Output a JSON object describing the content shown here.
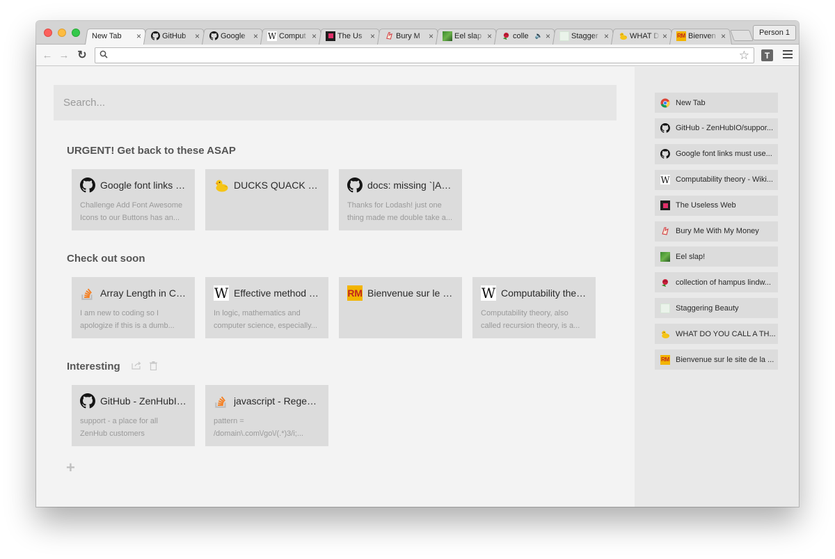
{
  "browser": {
    "profile_label": "Person 1",
    "tabs": [
      {
        "title": "New Tab",
        "icon": "none",
        "active": true
      },
      {
        "title": "GitHub",
        "icon": "github-icon"
      },
      {
        "title": "Google",
        "icon": "github-icon"
      },
      {
        "title": "Comput",
        "icon": "wikipedia-icon"
      },
      {
        "title": "The Us",
        "icon": "useless-web-icon"
      },
      {
        "title": "Bury M",
        "icon": "money-icon"
      },
      {
        "title": "Eel slap",
        "icon": "eel-icon"
      },
      {
        "title": "colle",
        "icon": "rose-icon",
        "audio": "speaker-icon"
      },
      {
        "title": "Stagger",
        "icon": "staggering-icon"
      },
      {
        "title": "WHAT D",
        "icon": "duck-icon"
      },
      {
        "title": "Bienven",
        "icon": "rm-icon"
      }
    ],
    "tab_close_glyph": "×",
    "omnibox": {
      "value": "",
      "placeholder": ""
    },
    "extension_label": "T"
  },
  "search": {
    "placeholder": "Search..."
  },
  "groups": [
    {
      "title": "URGENT! Get back to these ASAP",
      "cards": [
        {
          "icon": "github-icon",
          "title": "Google font links m...",
          "desc": "Challenge Add Font Awesome Icons to our Buttons has an..."
        },
        {
          "icon": "duck-icon",
          "title": "DUCKS QUACK ME ...",
          "desc": ""
        },
        {
          "icon": "github-icon",
          "title": "docs: missing `|Arr...",
          "desc": "Thanks for Lodash! just one thing made me double take a..."
        }
      ]
    },
    {
      "title": "Check out soon",
      "cards": [
        {
          "icon": "stackoverflow-icon",
          "title": "Array Length in C - ...",
          "desc": "I am new to coding so I apologize if this is a dumb..."
        },
        {
          "icon": "wikipedia-icon",
          "title": "Effective method - ...",
          "desc": "In logic, mathematics and computer science, especially..."
        },
        {
          "icon": "rm-icon",
          "title": "Bienvenue sur le sit...",
          "desc": ""
        },
        {
          "icon": "wikipedia-icon",
          "title": "Computability theo...",
          "desc": "Computability theory, also called recursion theory, is a..."
        }
      ]
    },
    {
      "title": "Interesting",
      "tools": [
        "share-icon",
        "trash-icon"
      ],
      "cards": [
        {
          "icon": "github-icon",
          "title": "GitHub - ZenHubIO/...",
          "desc": "support - a place for all ZenHub customers"
        },
        {
          "icon": "stackoverflow-icon",
          "title": "javascript - Regex fi...",
          "desc": "pattern = /domain\\.com\\/go\\/(.*)3/i;..."
        }
      ]
    }
  ],
  "add_group_label": "+",
  "sidebar": {
    "items": [
      {
        "icon": "chrome-icon",
        "label": "New Tab"
      },
      {
        "icon": "github-icon",
        "label": "GitHub - ZenHubIO/suppor..."
      },
      {
        "icon": "github-icon",
        "label": "Google font links must use..."
      },
      {
        "icon": "wikipedia-icon",
        "label": "Computability theory - Wiki..."
      },
      {
        "icon": "useless-web-icon",
        "label": "The Useless Web"
      },
      {
        "icon": "money-icon",
        "label": "Bury Me With My Money"
      },
      {
        "icon": "eel-icon",
        "label": "Eel slap!"
      },
      {
        "icon": "rose-icon",
        "label": "collection of hampus lindw..."
      },
      {
        "icon": "staggering-icon",
        "label": "Staggering Beauty"
      },
      {
        "icon": "duck-icon",
        "label": "WHAT DO YOU CALL A TH..."
      },
      {
        "icon": "rm-icon",
        "label": "Bienvenue sur le site de la ..."
      }
    ]
  },
  "colors": {
    "chrome_frame": "#d4d4d4",
    "card_bg": "#dcdcdc",
    "sidebar_bg": "#e9e9e9",
    "stackoverflow_orange": "#f48024",
    "rm_yellow": "#f2b400"
  }
}
